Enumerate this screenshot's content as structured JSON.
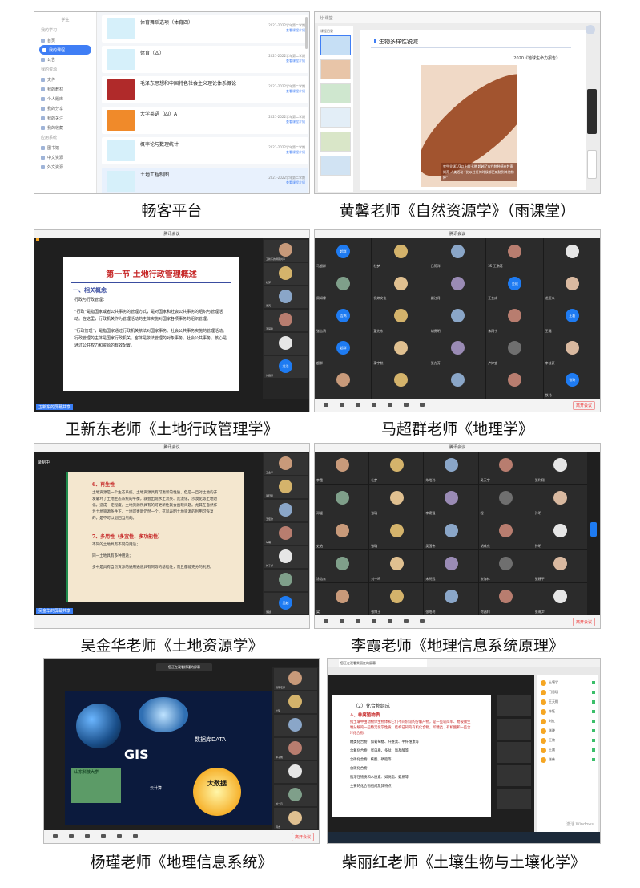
{
  "captions": {
    "p1": "畅客平台",
    "p2": "黄馨老师《自然资源学》（雨课堂）",
    "p3": "卫新东老师《土地行政管理学》",
    "p4": "马超群老师《地理学》",
    "p5": "吴金华老师《土地资源学》",
    "p6": "李霞老师《地理信息系统原理》",
    "p7": "杨瑾老师《地理信息系统》",
    "p8": "柴丽红老师《土壤生物与土壤化学》"
  },
  "p1": {
    "brand": "学生",
    "nav_sections": [
      {
        "section": "我的学习",
        "items": [
          "首页",
          "我的课程",
          "公告"
        ]
      },
      {
        "section": "我的资源",
        "items": [
          "文件",
          "我的教材",
          "个人题库",
          "我的分享",
          "我的关注",
          "我的收藏"
        ]
      },
      {
        "section": "应用系统",
        "items": [
          "图书馆",
          "中文资源",
          "外文资源"
        ]
      }
    ],
    "active_item": "我的课程",
    "courses": [
      {
        "name": "体育舞蹈选项（体育四）",
        "term": "2021-2022学年第二学期",
        "link": "查看课程介绍",
        "color": "#d6f0fa"
      },
      {
        "name": "体育（四）",
        "term": "2021-2022学年第二学期",
        "link": "查看课程介绍",
        "color": "#d6f0fa"
      },
      {
        "name": "毛泽东思想和中国特色社会主义理论体系概论",
        "term": "2021-2022学年第二学期",
        "link": "查看课程介绍",
        "color": "#b02a2a"
      },
      {
        "name": "大学英语（四）A",
        "term": "2021-2022学年第二学期",
        "link": "查看课程介绍",
        "color": "#f08a2a"
      },
      {
        "name": "概率论与数理统计",
        "term": "2021-2022学年第二学期",
        "link": "查看课程介绍",
        "color": "#d6f0fa"
      },
      {
        "name": "土地工程制图",
        "term": "2021-2022学年第二学期",
        "link": "查看课程介绍",
        "color": "#d6f0fa"
      }
    ]
  },
  "p2": {
    "topbar": "分·课堂",
    "thumbs_header": "课程目录",
    "slide_title": "生物多样性锐减",
    "report": "2020《地球生命力报告》",
    "art_caption": "农牛全球1/3以上的土地 超越了农作物种植在牲畜饲养 人类活动 “比以往任何时候都更威胁到其他物种”"
  },
  "p3": {
    "window_title": "腾讯会议",
    "slide_title": "第一节   土地行政管理概述",
    "section": "一、相关概念",
    "body": [
      "行政与行政管理：",
      "“行政”是指国家或者公共事务的管理方式，是对国家和社会公共事务的组织与管理活动。在这里，行政机关作为管理活动的主体实施对国家各项事务的组织管理。",
      "“行政管理”，是指国家通过行政机关依法对国家事务、社会公共事务实施的管理活动。行政管理的主体是国家行政机关，客体是依法管理的对象事务，社会公共事务，核心是通过公共权力和资源的有效配置。"
    ],
    "share_label": "卫新东的屏幕共享",
    "participants": [
      "卫新东的屏幕共享",
      "杜梦",
      "谢天",
      "汤润秋",
      "",
      "刘昌伟"
    ],
    "avatar_text": "龙浩"
  },
  "p4": {
    "window_title": "腾讯会议",
    "time": "00:07",
    "names": [
      "马超群",
      "杜梦",
      "吕锦洋",
      "35-王鹏茗",
      "",
      "周如缘",
      "祝婷文佳",
      "纲江月",
      "王金成",
      "龙亚义",
      "张吉鸿",
      "董先东",
      "胡贵明",
      "朱翔宇",
      "王磊",
      "超群",
      "秦宇航",
      "张方芳",
      "卢婷宜",
      "李佳豪",
      "",
      "",
      "",
      "",
      "铁玮"
    ],
    "badges": {
      "金成": "金成",
      "吉鸿": "吉鸿",
      "王磊": "王磊",
      "超群": "超群",
      "铁玮": "铁玮"
    },
    "leave": "离开会议"
  },
  "p5": {
    "window_title": "腾讯会议",
    "recording": "录制中",
    "sections": [
      {
        "title": "6、再生性",
        "lines": [
          "土地资源是一个生态系统，土地资源具有可更新的性质，但是一旦对土地的开发破坏了土地生态系统的平衡，就会出现水土流失、荒漠化，沙漠化等土地退化，造成一定程度，土地资源所具有的可更新性就会出现问题。尤其在自然作为土地资源条件下，土地可更新仍然一个，这就表明土地资源的利用可恢复的，是不可以退回当然的。"
        ]
      },
      {
        "title": "7、多用性（多宜性、多功能性）",
        "lines": [
          "不同的土地具有不同的用途；",
          "同一土地具有多种用途；",
          "多中是具有自然资源的通用通道具有同等的基础性，而且都能充分的利用。"
        ]
      }
    ],
    "share_label": "吴金华的屏幕共享",
    "participants": [
      "王金华",
      "郭轩鹏",
      "王佳欣",
      "马萌",
      "刘子乔",
      "",
      "吴越"
    ],
    "avatar_text": "吴越"
  },
  "p6": {
    "window_title": "腾讯会议",
    "time": "02:54",
    "names": [
      "李霞",
      "杜梦",
      "朱皓玮",
      "吴天宇",
      "张利翔",
      "邓媛",
      "张瑞",
      "李建强",
      "程",
      "孙明",
      "史皓",
      "张瑞",
      "吴国伟",
      "胡成杰",
      "孙明",
      "涂浩东",
      "刘一鸣",
      "宋明远",
      "张海林",
      "张建平",
      "梁",
      "张博玉",
      "张皓玥",
      "何涵利",
      "张瀚尹"
    ],
    "leave": "离开会议"
  },
  "p7": {
    "banner": "您正在观看杨瑾的屏幕",
    "gis": "GIS",
    "db": "数据库DATA",
    "cloud": "云计算",
    "bigdata": "大数据",
    "school": "山东科技大学",
    "time": "00:13",
    "participants": [
      "杨瑾老师",
      "杜梦",
      "",
      "郭子成",
      "",
      "刘一凡",
      "诗杰",
      ""
    ],
    "leave": "离开会议"
  },
  "p8": {
    "tab": "您正在观看柴丽红的屏幕",
    "heading": "（2）化合物组成",
    "sub": "A、非腐殖物质",
    "body": [
      "指土壤中由动物体生物体和它们不同阶段的分解产物，是一些较简单、易被微生物分解的一些特定化学性质、结构已知的有机化合物，如糖类、有机酸和一些含N化合物。",
      "糖类化合物：如葡萄糖、纤维素、半纤维素等",
      "含氮化合物：蛋白质、多肽、氨基酸等",
      "含磷化合物：核酸、磷脂等",
      "含硫化合物",
      "脂溶性物质和木质素：如树脂、蜡质等"
    ],
    "note": "主要的化合物组成及其特点",
    "chat_users": [
      "土壤学",
      "门思琪",
      "王天赐",
      "许钰",
      "刘红",
      "张晓",
      "王欣",
      "王晨",
      "张伟"
    ],
    "watermark": "激活 Windows"
  }
}
